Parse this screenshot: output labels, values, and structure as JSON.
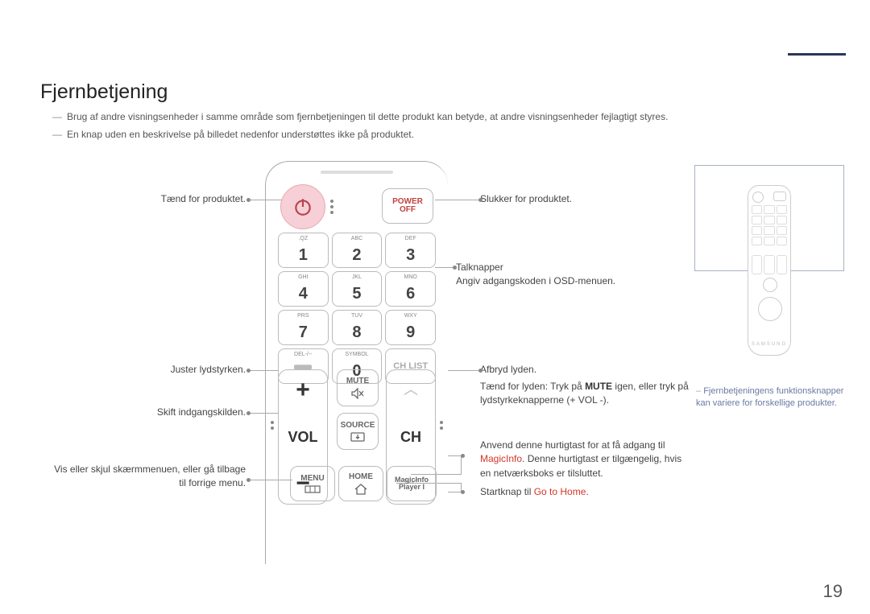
{
  "page": {
    "number": "19"
  },
  "heading": "Fjernbetjening",
  "notes": {
    "line1": "Brug af andre visningsenheder i samme område som fjernbetjeningen til dette produkt kan betyde, at andre visningsenheder fejlagtigt styres.",
    "line2": "En knap uden en beskrivelse på billedet nedenfor understøttes ikke på produktet."
  },
  "remote": {
    "power_off": {
      "l1": "POWER",
      "l2": "OFF"
    },
    "numpad": [
      {
        "letters": ".QZ",
        "digit": "1"
      },
      {
        "letters": "ABC",
        "digit": "2"
      },
      {
        "letters": "DEF",
        "digit": "3"
      },
      {
        "letters": "GHI",
        "digit": "4"
      },
      {
        "letters": "JKL",
        "digit": "5"
      },
      {
        "letters": "MNO",
        "digit": "6"
      },
      {
        "letters": "PRS",
        "digit": "7"
      },
      {
        "letters": "TUV",
        "digit": "8"
      },
      {
        "letters": "WXY",
        "digit": "9"
      },
      {
        "letters": "DEL-/--",
        "digit": ""
      },
      {
        "letters": "SYMBOL",
        "digit": "0"
      },
      {
        "letters": "",
        "digit": ""
      }
    ],
    "chlist": "CH LIST",
    "vol_label": "VOL",
    "ch_label": "CH",
    "mute": "MUTE",
    "source": "SOURCE",
    "menu": "MENU",
    "home": "HOME",
    "magic": {
      "l1": "MagicInfo",
      "l2": "Player I"
    },
    "inset_brand": "SAMSUNG"
  },
  "callouts": {
    "left": {
      "power_on": "Tænd for produktet.",
      "volume": "Juster lydstyrken.",
      "source": "Skift indgangskilden.",
      "menu_l1": "Vis eller skjul skærmmenuen, eller gå tilbage",
      "menu_l2": "til forrige menu."
    },
    "right": {
      "power_off": "Slukker for produktet.",
      "numbers_l1": "Talknapper",
      "numbers_l2": "Angiv adgangskoden i OSD-menuen.",
      "mute": "Afbryd lyden.",
      "mute2a": "Tænd for lyden: Tryk på ",
      "mute2b": "MUTE",
      "mute2c": " igen, eller tryk på lydstyrkeknapperne (+ VOL -).",
      "magic_l1a": "Anvend denne hurtigtast for at få adgang til ",
      "magic_l1b": "MagicInfo",
      "magic_l1c": ". Denne hurtigtast er tilgængelig, hvis en netværksboks er tilsluttet.",
      "home_a": "Startknap til ",
      "home_b": "Go to Home",
      "home_c": "."
    }
  },
  "side_note": {
    "l1": "Fjernbetjeningens funktionsknapper",
    "l2": "kan variere for forskellige produkter."
  }
}
